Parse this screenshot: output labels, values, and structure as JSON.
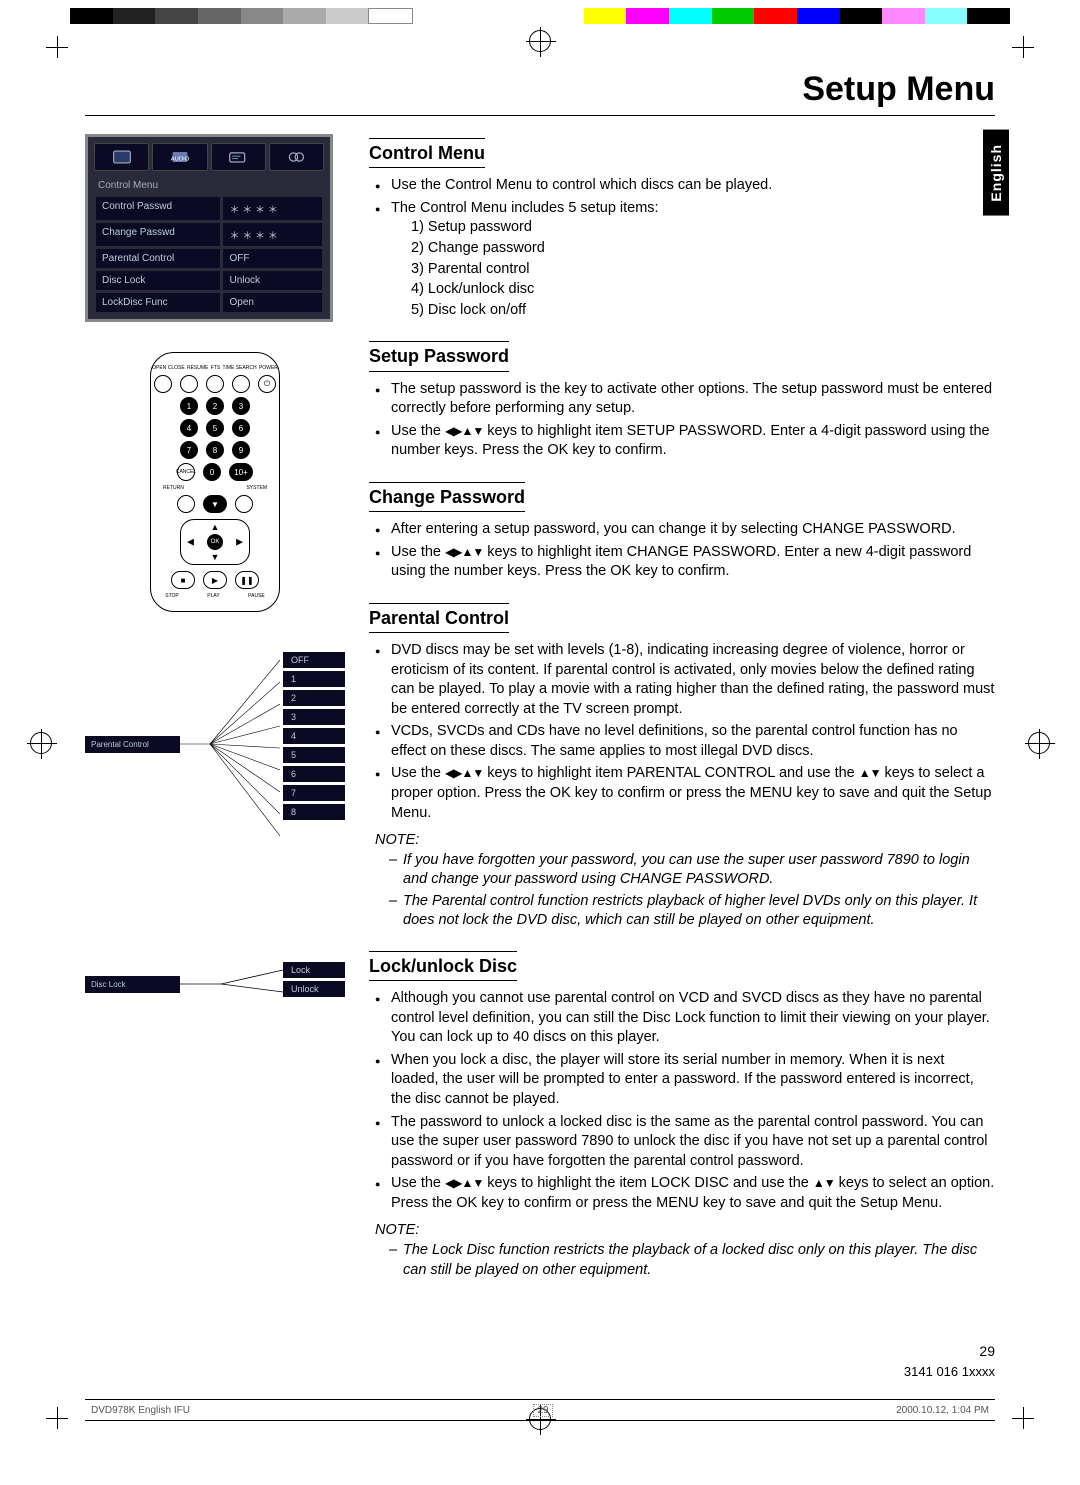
{
  "page_title": "Setup Menu",
  "language_tab": "English",
  "page_number": "29",
  "document_id": "3141 016 1xxxx",
  "footer": {
    "file": "DVD978K English IFU",
    "page": "29",
    "timestamp": "2000.10.12, 1:04 PM"
  },
  "osd": {
    "title": "Control Menu",
    "rows": [
      {
        "key": "Control Passwd",
        "val": "＊ ＊ ＊ ＊"
      },
      {
        "key": "Change Passwd",
        "val": "＊ ＊ ＊ ＊"
      },
      {
        "key": "Parental Control",
        "val": "OFF"
      },
      {
        "key": "Disc Lock",
        "val": "Unlock"
      },
      {
        "key": "LockDisc Func",
        "val": "Open"
      }
    ]
  },
  "remote": {
    "top_labels": [
      "OPEN CLOSE",
      "RESUME",
      "FTS",
      "TIME SEARCH",
      "POWER"
    ],
    "digits": [
      "1",
      "2",
      "3",
      "4",
      "5",
      "6",
      "7",
      "8",
      "9",
      "0",
      "10+"
    ],
    "cancel": "CANCEL",
    "return": "RETURN",
    "system": "SYSTEM",
    "ok": "OK",
    "bottom_labels": [
      "STOP",
      "PLAY",
      "PAUSE"
    ]
  },
  "parental_diagram": {
    "label": "Parental Control",
    "levels": [
      "OFF",
      "1",
      "2",
      "3",
      "4",
      "5",
      "6",
      "7",
      "8"
    ]
  },
  "disclock_diagram": {
    "label": "Disc Lock",
    "options": [
      "Lock",
      "Unlock"
    ]
  },
  "sections": {
    "control_menu": {
      "heading": "Control Menu",
      "bullets": [
        "Use the Control Menu to control which discs can be played.",
        "The Control Menu includes 5 setup items:"
      ],
      "enum": [
        "1)   Setup password",
        "2)   Change password",
        "3)   Parental control",
        "4)   Lock/unlock disc",
        "5)   Disc lock on/off"
      ]
    },
    "setup_password": {
      "heading": "Setup Password",
      "b1": "The setup password is the key to activate other options. The setup password must be entered correctly before performing any setup.",
      "b2a": "Use the ",
      "b2b": " keys to highlight item SETUP PASSWORD. Enter a 4-digit password using the number keys. Press the OK key to confirm."
    },
    "change_password": {
      "heading": "Change Password",
      "b1": "After entering a setup password, you can change it by selecting CHANGE PASSWORD.",
      "b2a": "Use the ",
      "b2b": " keys to highlight item CHANGE PASSWORD. Enter a new 4-digit password using the number keys. Press the OK key to confirm."
    },
    "parental_control": {
      "heading": "Parental Control",
      "b1": "DVD discs may be set with levels (1-8), indicating increasing degree of violence, horror or eroticism of its content. If parental control is activated, only movies below the defined rating can be played. To play a movie with a rating higher than the defined rating, the password must be entered correctly at the TV screen prompt.",
      "b2": "VCDs, SVCDs and CDs have no level definitions, so the parental control function has no effect on these discs. The same applies to most illegal DVD discs.",
      "b3a": "Use the ",
      "b3b": " keys to highlight item PARENTAL CONTROL and use the ",
      "b3c": " keys to select a proper option. Press the OK key to confirm or press the MENU key to save and quit the Setup Menu.",
      "note_head": "NOTE:",
      "note1": "If you have forgotten your password, you can use the super user password 7890 to login and change your password using CHANGE PASSWORD.",
      "note2": "The Parental control function restricts playback of higher level DVDs only on this player. It does not lock the DVD disc, which can still be played on other equipment."
    },
    "lock_unlock": {
      "heading": "Lock/unlock Disc",
      "b1": "Although you cannot use parental control on VCD and SVCD discs as they have no parental control level definition, you can still the Disc Lock function to limit their viewing on your player. You can lock up to 40 discs on this player.",
      "b2": "When you lock a disc, the player will store its serial number in memory. When it is next loaded, the user will be prompted to enter a password. If the password entered is incorrect, the disc cannot be played.",
      "b3": "The password to unlock a locked disc is the same as the parental control password. You can use the super user password 7890 to unlock the disc if you have not set up a parental control password or if you have forgotten the parental control password.",
      "b4a": "Use the ",
      "b4b": " keys to highlight the item LOCK DISC and use the ",
      "b4c": " keys to select an option. Press the OK key to confirm or press the MENU key to save and quit the Setup Menu.",
      "note_head": "NOTE:",
      "note1": "The Lock Disc function restricts the playback of a locked disc only on this player. The disc can still be played on other equipment."
    }
  },
  "arrow_glyphs": {
    "lrud": "◀▶▲▼",
    "ud": "▲▼"
  }
}
